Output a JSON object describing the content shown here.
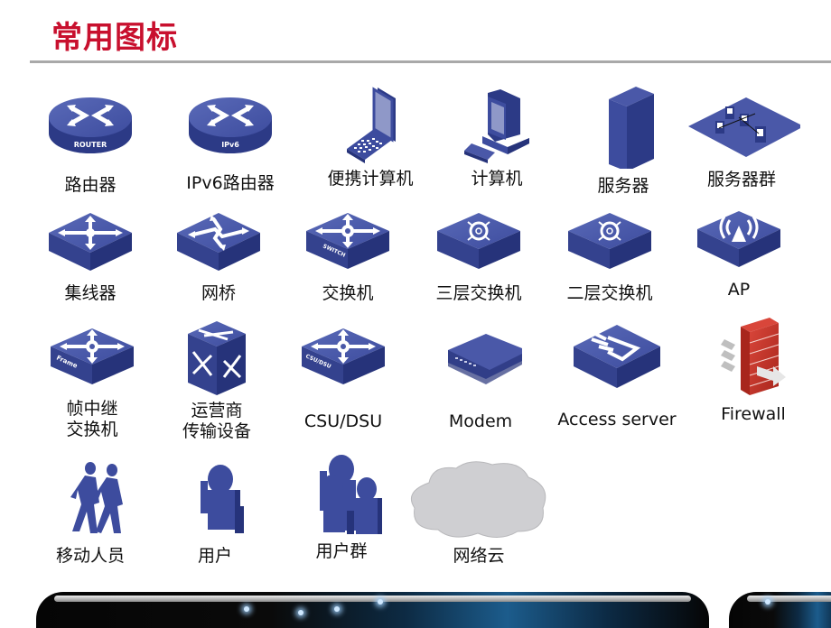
{
  "page": {
    "title": "常用图标",
    "accent_color": "#c8102e",
    "icon_color": "#3b4a9c",
    "firewall_color": "#c0392b",
    "cloud_color": "#cfcfd2"
  },
  "icons": [
    {
      "id": "router",
      "icon": "router-icon",
      "label": "路由器",
      "badge": "ROUTER"
    },
    {
      "id": "ipv6-router",
      "icon": "ipv6-router-icon",
      "label": "IPv6路由器",
      "badge": "IPv6"
    },
    {
      "id": "laptop",
      "icon": "laptop-icon",
      "label": "便携计算机"
    },
    {
      "id": "computer",
      "icon": "computer-icon",
      "label": "计算机"
    },
    {
      "id": "server",
      "icon": "server-icon",
      "label": "服务器"
    },
    {
      "id": "server-farm",
      "icon": "server-farm-icon",
      "label": "服务器群"
    },
    {
      "id": "hub",
      "icon": "hub-icon",
      "label": "集线器"
    },
    {
      "id": "bridge",
      "icon": "bridge-icon",
      "label": "网桥"
    },
    {
      "id": "switch",
      "icon": "switch-icon",
      "label": "交换机",
      "badge": "SWITCH"
    },
    {
      "id": "l3-switch",
      "icon": "l3-switch-icon",
      "label": "三层交换机"
    },
    {
      "id": "l2-switch",
      "icon": "l2-switch-icon",
      "label": "二层交换机"
    },
    {
      "id": "ap",
      "icon": "access-point-icon",
      "label": "AP"
    },
    {
      "id": "frame-relay",
      "icon": "frame-relay-switch-icon",
      "label_line1": "帧中继",
      "label_line2": "交换机",
      "badge": "Frame"
    },
    {
      "id": "carrier",
      "icon": "carrier-transport-icon",
      "label_line1": "运营商",
      "label_line2": "传输设备"
    },
    {
      "id": "csu-dsu",
      "icon": "csu-dsu-icon",
      "label": "CSU/DSU",
      "badge": "CSU/DSU"
    },
    {
      "id": "modem",
      "icon": "modem-icon",
      "label": "Modem"
    },
    {
      "id": "access-server",
      "icon": "access-server-icon",
      "label": "Access server"
    },
    {
      "id": "firewall",
      "icon": "firewall-icon",
      "label": "Firewall"
    },
    {
      "id": "mobile-users",
      "icon": "mobile-users-icon",
      "label": "移动人员"
    },
    {
      "id": "user",
      "icon": "user-icon",
      "label": "用户"
    },
    {
      "id": "user-group",
      "icon": "user-group-icon",
      "label": "用户群"
    },
    {
      "id": "network-cloud",
      "icon": "network-cloud-icon",
      "label": "网络云"
    }
  ]
}
